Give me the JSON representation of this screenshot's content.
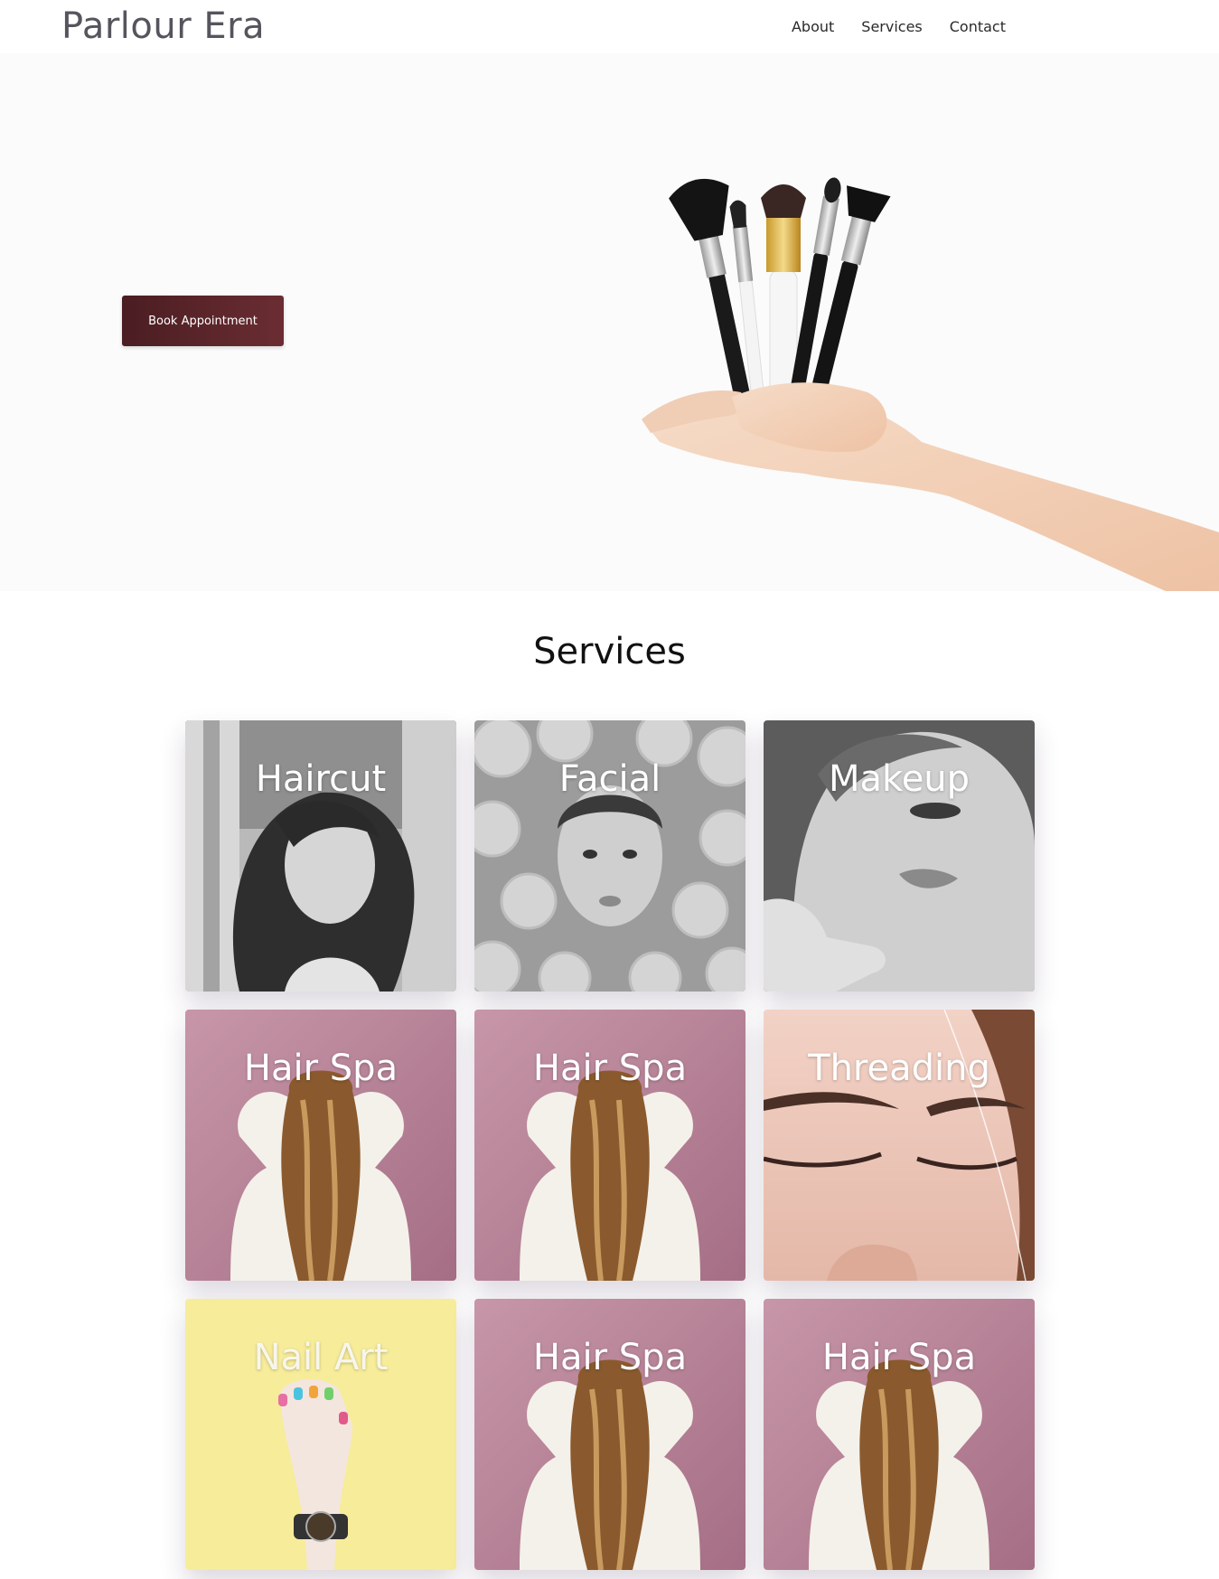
{
  "header": {
    "brand": "Parlour Era",
    "nav": [
      "About",
      "Services",
      "Contact"
    ]
  },
  "hero": {
    "book_button": "Book Appointment",
    "image_alt": "hand holding makeup brushes"
  },
  "services": {
    "title": "Services",
    "cards": [
      {
        "label": "Haircut",
        "image": "bw-portrait"
      },
      {
        "label": "Facial",
        "image": "bw-citrus-face"
      },
      {
        "label": "Makeup",
        "image": "bw-makeup"
      },
      {
        "label": "Hair Spa",
        "image": "pink-hair-back"
      },
      {
        "label": "Hair Spa",
        "image": "pink-hair-back"
      },
      {
        "label": "Threading",
        "image": "eyebrow-closeup"
      },
      {
        "label": "Nail Art",
        "image": "yellow-nail-hand"
      },
      {
        "label": "Hair Spa",
        "image": "pink-hair-back"
      },
      {
        "label": "Hair Spa",
        "image": "pink-hair-back"
      }
    ]
  },
  "colors": {
    "brand_text": "#55555d",
    "button": "#4a1d22",
    "hero_bg": "#fbfbfb"
  }
}
